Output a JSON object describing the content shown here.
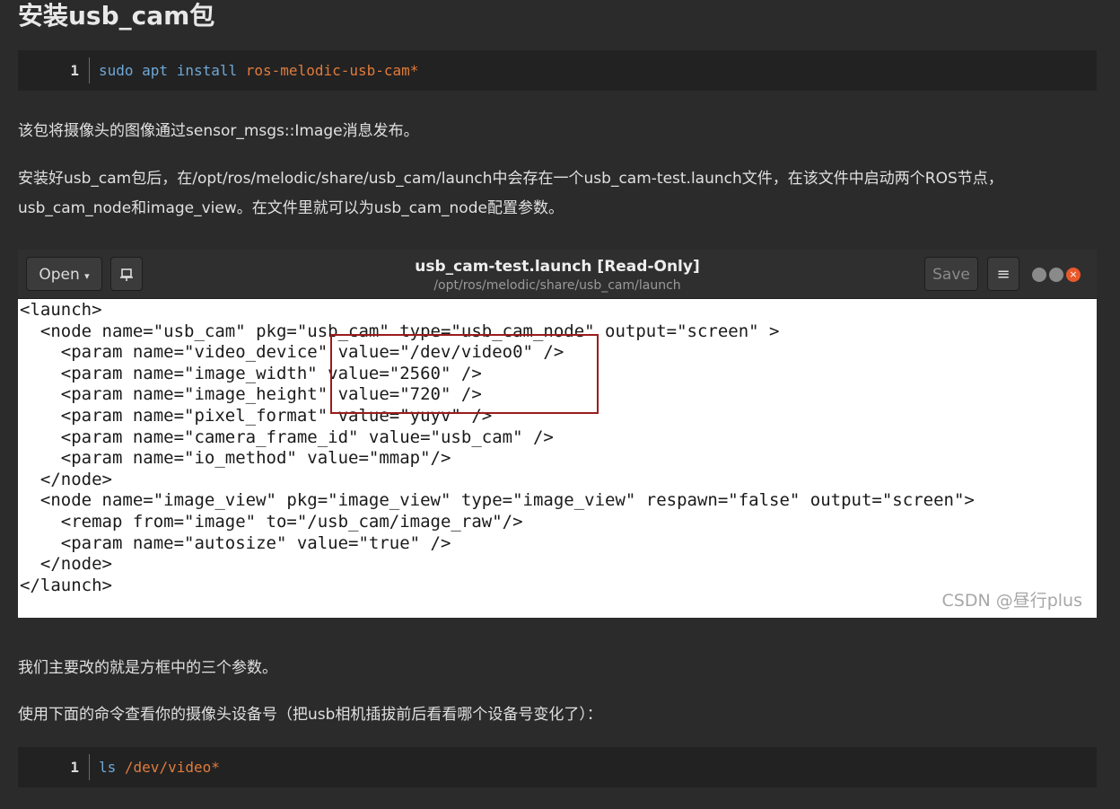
{
  "heading": "安装usb_cam包",
  "code1": {
    "line": "1",
    "cmd": "sudo apt install ",
    "arg": "ros-melodic-usb-cam*"
  },
  "para1": "该包将摄像头的图像通过sensor_msgs::Image消息发布。",
  "para2": "安装好usb_cam包后，在/opt/ros/melodic/share/usb_cam/launch中会存在一个usb_cam-test.launch文件，在该文件中启动两个ROS节点，usb_cam_node和image_view。在文件里就可以为usb_cam_node配置参数。",
  "window": {
    "open_label": "Open",
    "title": "usb_cam-test.launch [Read-Only]",
    "subtitle": "/opt/ros/melodic/share/usb_cam/launch",
    "save_label": "Save",
    "menu_icon": "hamburger-icon",
    "pin_icon": "document-icon",
    "lines": [
      "<launch>",
      "  <node name=\"usb_cam\" pkg=\"usb_cam\" type=\"usb_cam_node\" output=\"screen\" >",
      "    <param name=\"video_device\" value=\"/dev/video0\" />",
      "    <param name=\"image_width\" value=\"2560\" />",
      "    <param name=\"image_height\" value=\"720\" />",
      "    <param name=\"pixel_format\" value=\"yuyv\" />",
      "    <param name=\"camera_frame_id\" value=\"usb_cam\" />",
      "    <param name=\"io_method\" value=\"mmap\"/>",
      "  </node>",
      "  <node name=\"image_view\" pkg=\"image_view\" type=\"image_view\" respawn=\"false\" output=\"screen\">",
      "    <remap from=\"image\" to=\"/usb_cam/image_raw\"/>",
      "    <param name=\"autosize\" value=\"true\" />",
      "  </node>",
      "</launch>"
    ],
    "watermark": "CSDN @昼行plus"
  },
  "para3": "我们主要改的就是方框中的三个参数。",
  "para4": "使用下面的命令查看你的摄像头设备号（把usb相机插拔前后看看哪个设备号变化了）：",
  "code2": {
    "line": "1",
    "cmd": "ls ",
    "arg": "/dev/video*"
  }
}
